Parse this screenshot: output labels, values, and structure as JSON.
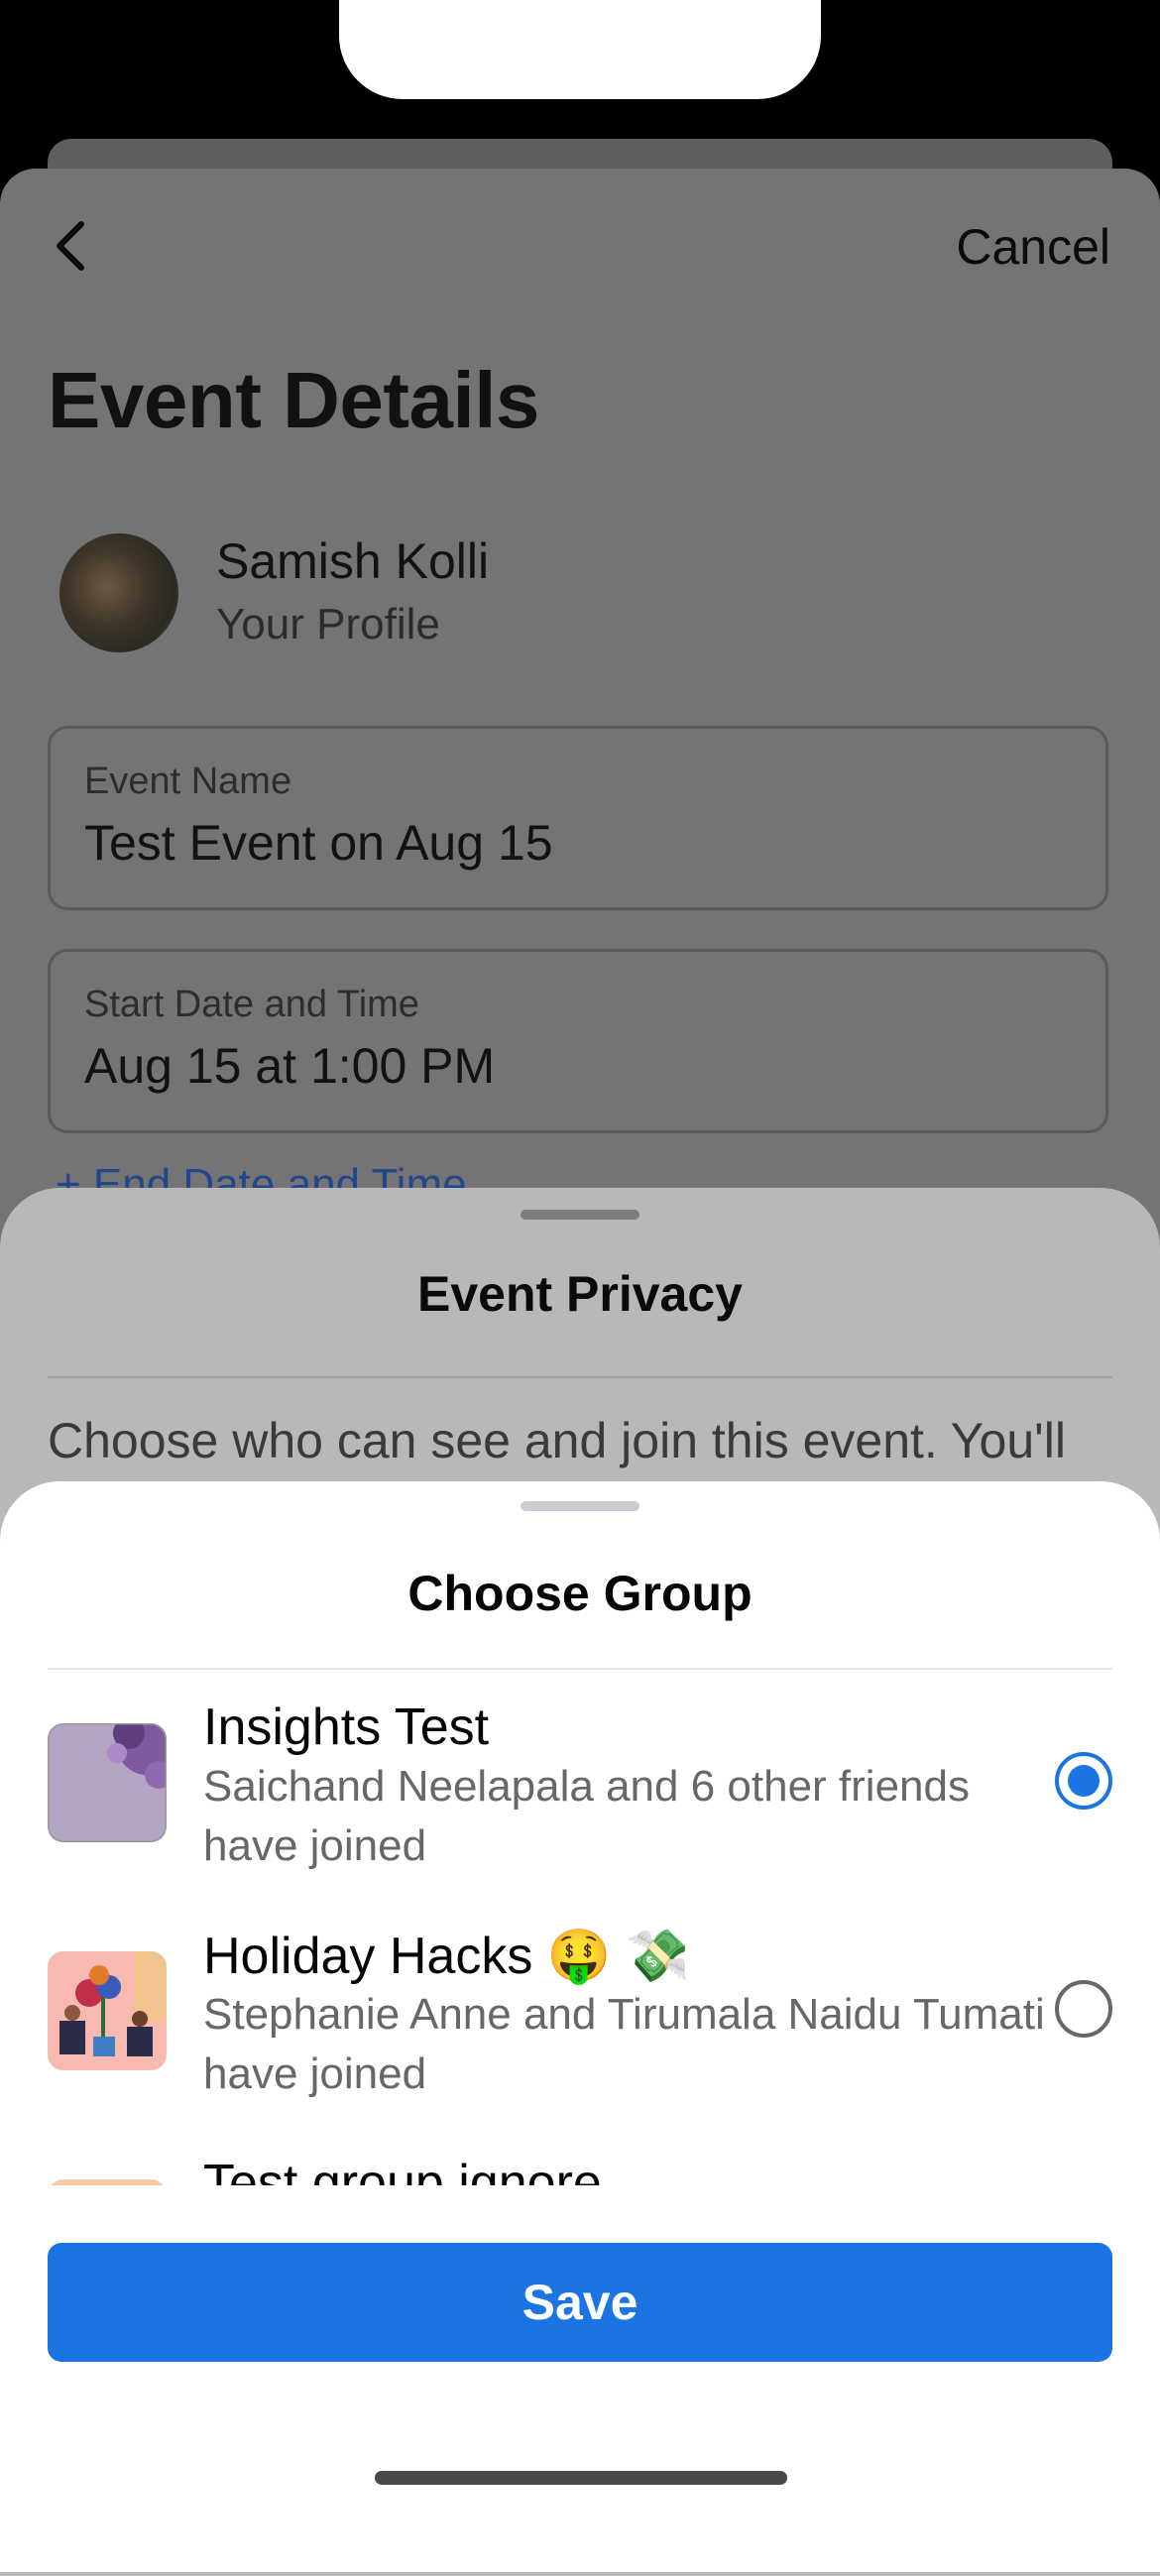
{
  "header": {
    "cancel_label": "Cancel",
    "back_icon": "chevron-left-icon"
  },
  "page_title": "Event Details",
  "profile": {
    "name": "Samish Kolli",
    "subtitle": "Your Profile"
  },
  "fields": [
    {
      "label": "Event Name",
      "value": "Test Event on Aug 15"
    },
    {
      "label": "Start Date and Time",
      "value": "Aug 15 at 1:00 PM"
    }
  ],
  "end_date_link": "+ End Date and Time",
  "privacy_sheet": {
    "title": "Event Privacy",
    "description": "Choose who can see and join this event. You'll"
  },
  "group_sheet": {
    "title": "Choose Group",
    "groups": [
      {
        "name": "Insights Test",
        "members": "Saichand Neelapala and 6 other friends have joined",
        "selected": true
      },
      {
        "name": "Holiday Hacks 🤑 💸",
        "members": "Stephanie Anne and Tirumala Naidu Tumati have joined",
        "selected": false
      },
      {
        "name": "Test group ignore",
        "members": "",
        "selected": false
      }
    ],
    "save_label": "Save"
  },
  "colors": {
    "accent": "#1b74e4",
    "secondary_text": "#65676b"
  }
}
